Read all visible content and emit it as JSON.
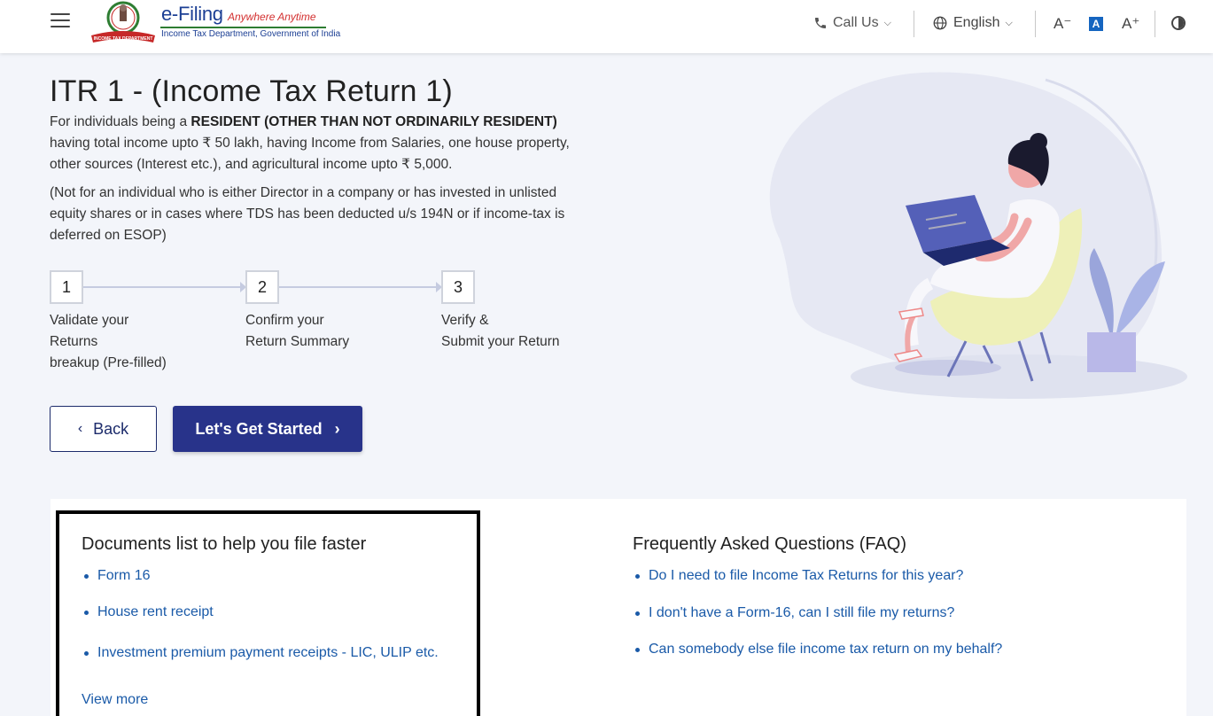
{
  "header": {
    "brand_title": "e-Filing",
    "brand_tagline": "Anywhere Anytime",
    "brand_subtitle": "Income Tax Department, Government of India",
    "emblem_banner": "INCOME TAX DEPARTMENT",
    "call_us": "Call Us",
    "language": "English",
    "font_decrease": "A⁻",
    "font_default": "A",
    "font_increase": "A⁺"
  },
  "main": {
    "title": "ITR 1 - (Income Tax Return 1)",
    "desc_prefix": "For individuals being a ",
    "desc_bold": "RESIDENT (OTHER THAN NOT ORDINARILY RESIDENT)",
    "desc_suffix": "having total income upto ₹ 50 lakh, having Income from Salaries, one house property, other sources (Interest etc.), and agricultural income upto ₹ 5,000.",
    "note": "(Not for an individual who is either Director in a company or has invested in unlisted equity shares or in cases where TDS has been deducted u/s 194N or if income-tax is deferred on ESOP)",
    "steps": [
      {
        "number": "1",
        "line1": "Validate your",
        "line2": "Returns",
        "line3": "breakup (Pre-filled)"
      },
      {
        "number": "2",
        "line1": "Confirm your",
        "line2": "Return Summary",
        "line3": ""
      },
      {
        "number": "3",
        "line1": "Verify &",
        "line2": "Submit your Return",
        "line3": ""
      }
    ],
    "back_label": "Back",
    "start_label": "Let's Get Started"
  },
  "documents": {
    "title": "Documents list to help you file faster",
    "items": [
      "Form 16",
      "House rent receipt",
      "Investment premium payment receipts - LIC, ULIP etc."
    ],
    "view_more": "View more"
  },
  "faq": {
    "title": "Frequently Asked Questions (FAQ)",
    "items": [
      "Do I need to file Income Tax Returns for this year?",
      "I don't have a Form-16, can I still file my returns?",
      "Can somebody else file income tax return on my behalf?"
    ]
  },
  "colors": {
    "primary": "#28338a",
    "link": "#1a5aa8",
    "brand_blue": "#1c3f94",
    "tagline_red": "#d32f2f"
  }
}
